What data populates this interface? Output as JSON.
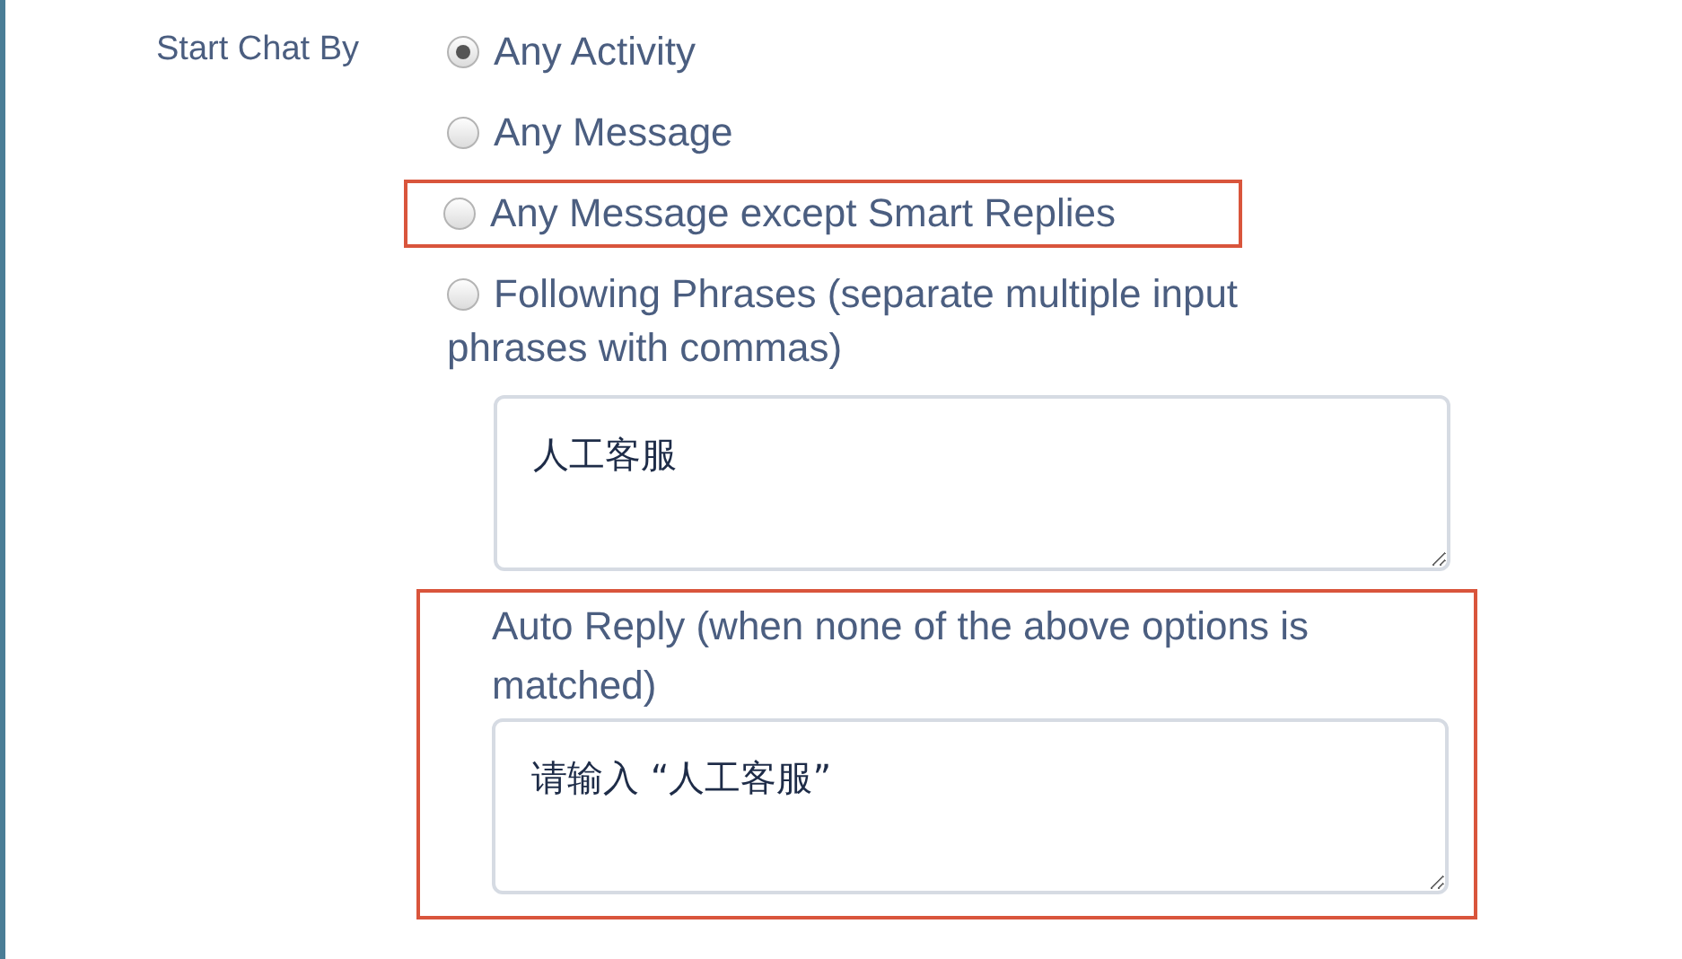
{
  "field": {
    "label": "Start Chat By",
    "options": [
      {
        "label": "Any Activity",
        "selected": true,
        "highlighted": false
      },
      {
        "label": "Any Message",
        "selected": false,
        "highlighted": false
      },
      {
        "label": "Any Message except Smart Replies",
        "selected": false,
        "highlighted": true
      },
      {
        "label": "Following Phrases (separate multiple input phrases with commas)",
        "selected": false,
        "highlighted": false
      }
    ],
    "phrases": {
      "value": "人工客服"
    },
    "auto_reply": {
      "label": "Auto Reply (when none of the above options is matched)",
      "value": "请输入 “人工客服”",
      "highlighted": true
    }
  }
}
